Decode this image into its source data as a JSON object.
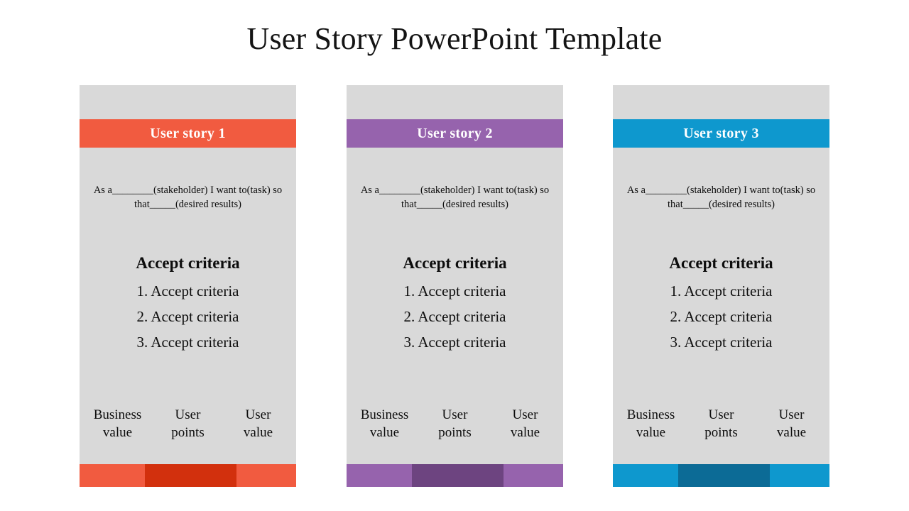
{
  "slide": {
    "title": "User Story PowerPoint Template",
    "background": "#ffffff",
    "card_background": "#d9d9d9"
  },
  "cards": [
    {
      "header_label": "User story 1",
      "header_color": "#f15b40",
      "footer_colors": [
        "#f15b40",
        "#d2300d",
        "#f15b40"
      ],
      "statement": "As a________(stakeholder)  I want to(task) so that_____(desired results)",
      "criteria_heading": "Accept criteria",
      "criteria": [
        "1. Accept criteria",
        "2. Accept criteria",
        "3. Accept criteria"
      ],
      "metrics": [
        {
          "line1": "Business",
          "line2": "value"
        },
        {
          "line1": "User",
          "line2": "points"
        },
        {
          "line1": "User",
          "line2": "value"
        }
      ]
    },
    {
      "header_label": "User story 2",
      "header_color": "#9663ad",
      "footer_colors": [
        "#9663ad",
        "#6d4480",
        "#9663ad"
      ],
      "statement": "As a________(stakeholder)  I want to(task) so that_____(desired results)",
      "criteria_heading": "Accept criteria",
      "criteria": [
        "1. Accept criteria",
        "2. Accept criteria",
        "3. Accept criteria"
      ],
      "metrics": [
        {
          "line1": "Business",
          "line2": "value"
        },
        {
          "line1": "User",
          "line2": "points"
        },
        {
          "line1": "User",
          "line2": "value"
        }
      ]
    },
    {
      "header_label": "User story 3",
      "header_color": "#0e98ce",
      "footer_colors": [
        "#0e98ce",
        "#0c6b96",
        "#0e98ce"
      ],
      "statement": "As a________(stakeholder)  I want to(task) so that_____(desired results)",
      "criteria_heading": "Accept criteria",
      "criteria": [
        "1. Accept criteria",
        "2. Accept criteria",
        "3. Accept criteria"
      ],
      "metrics": [
        {
          "line1": "Business",
          "line2": "value"
        },
        {
          "line1": "User",
          "line2": "points"
        },
        {
          "line1": "User",
          "line2": "value"
        }
      ]
    }
  ]
}
